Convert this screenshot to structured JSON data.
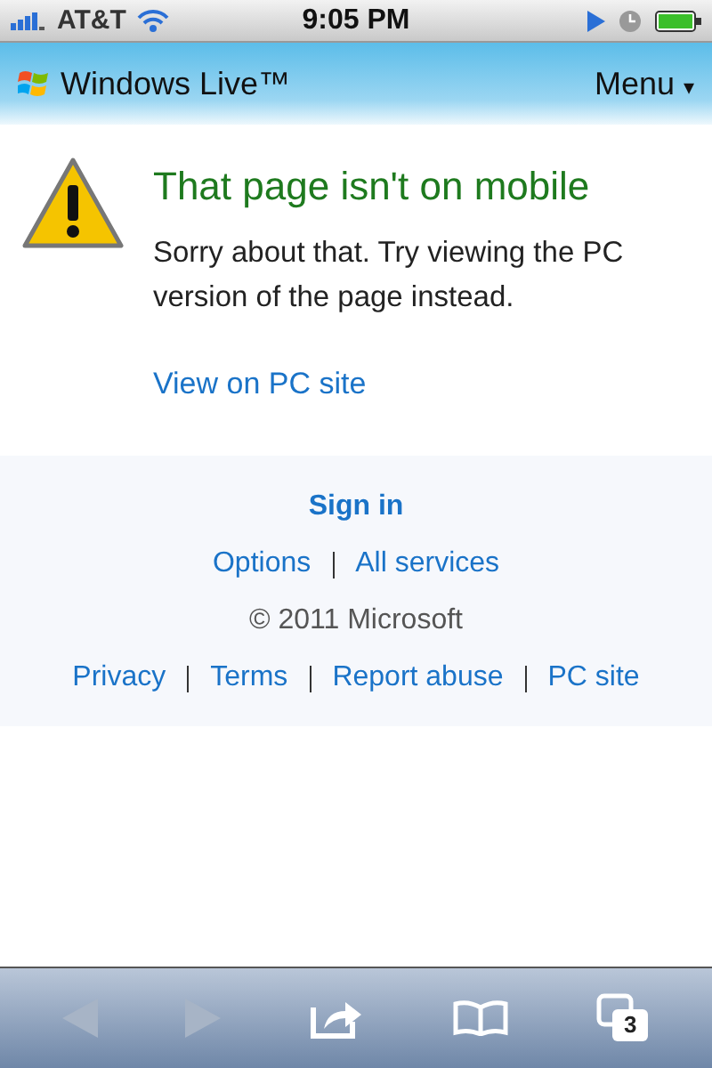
{
  "status_bar": {
    "carrier": "AT&T",
    "time": "9:05 PM"
  },
  "header": {
    "title": "Windows Live™",
    "menu": "Menu",
    "menu_caret": "▾"
  },
  "message": {
    "title": "That page isn't on mobile",
    "body": "Sorry about that. Try viewing the PC version of the page instead.",
    "link": "View on PC site"
  },
  "footer": {
    "sign_in": "Sign in",
    "links_row_1": [
      "Options",
      "All services"
    ],
    "copyright": "© 2011 Microsoft",
    "links_row_2": [
      "Privacy",
      "Terms",
      "Report abuse",
      "PC site"
    ]
  },
  "toolbar": {
    "back": {
      "disabled": true
    },
    "forward": {
      "disabled": true
    },
    "tabs_count": "3"
  }
}
